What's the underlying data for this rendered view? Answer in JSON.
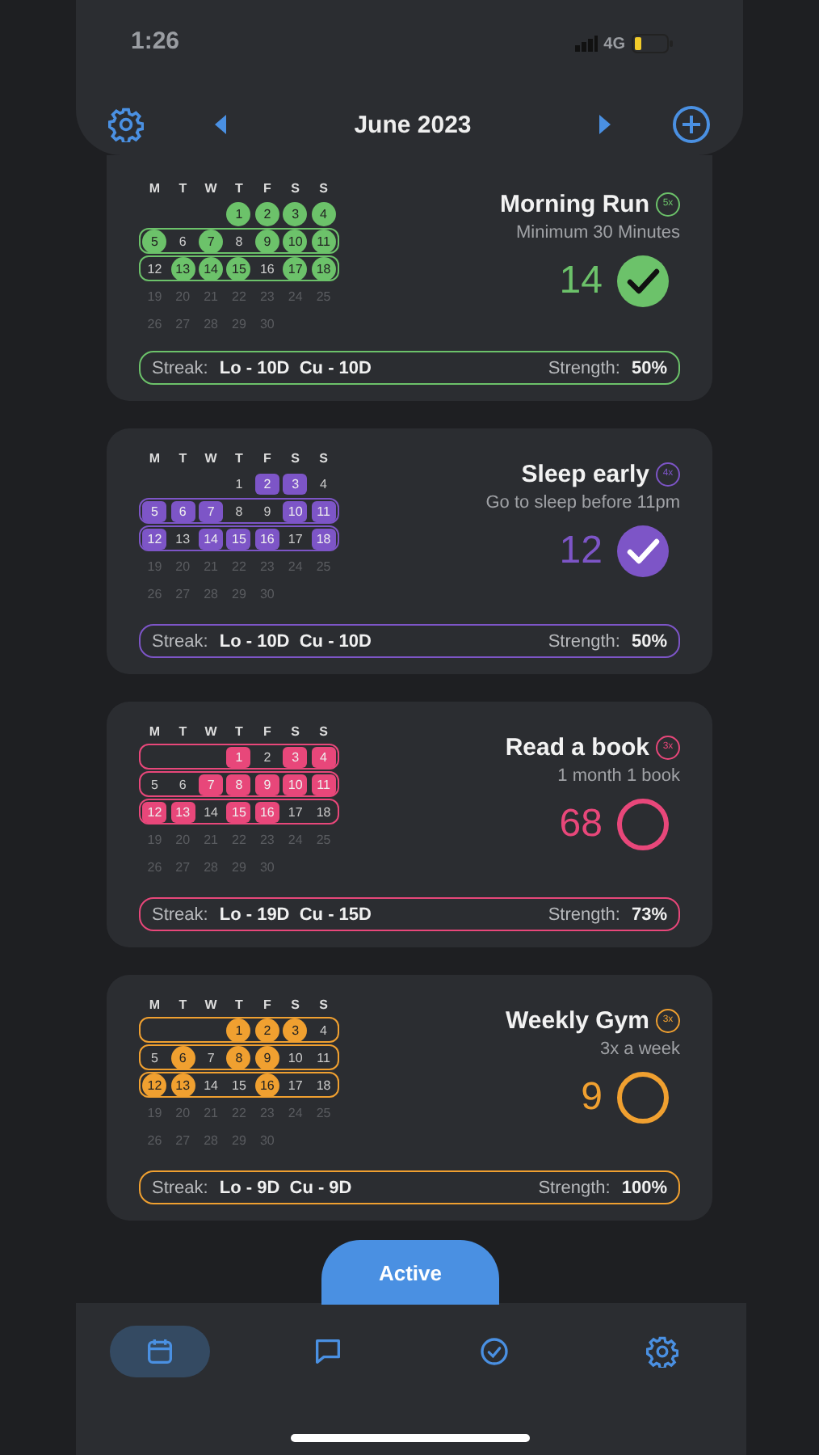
{
  "status_bar": {
    "time": "1:26",
    "network": "4G"
  },
  "header": {
    "month": "June 2023"
  },
  "habits": [
    {
      "name": "Morning Run",
      "kind": "round",
      "badge": "5x",
      "description": "Minimum 30 Minutes",
      "count": "14",
      "done": true,
      "color": "#6cc26a",
      "weekdays": [
        "M",
        "T",
        "W",
        "T",
        "F",
        "S",
        "S"
      ],
      "streak_label": "Streak:",
      "streak_value": "Lo - 10D  Cu - 10D",
      "strength_label": "Strength:",
      "strength_value": "50%",
      "weeks": [
        {
          "outlined": false,
          "starts_midweek": true,
          "days": [
            {
              "label": "1",
              "done": true,
              "future": false
            },
            {
              "label": "2",
              "done": true,
              "future": false
            },
            {
              "label": "3",
              "done": true,
              "future": false
            },
            {
              "label": "4",
              "done": true,
              "future": false
            }
          ]
        },
        {
          "outlined": true,
          "starts_midweek": false,
          "days": [
            {
              "label": "5",
              "done": true,
              "future": false
            },
            {
              "label": "6",
              "done": false,
              "future": false
            },
            {
              "label": "7",
              "done": true,
              "future": false
            },
            {
              "label": "8",
              "done": false,
              "future": false
            },
            {
              "label": "9",
              "done": true,
              "future": false
            },
            {
              "label": "10",
              "done": true,
              "future": false
            },
            {
              "label": "11",
              "done": true,
              "future": false
            }
          ]
        },
        {
          "outlined": true,
          "starts_midweek": false,
          "days": [
            {
              "label": "12",
              "done": false,
              "future": false
            },
            {
              "label": "13",
              "done": true,
              "future": false
            },
            {
              "label": "14",
              "done": true,
              "future": false
            },
            {
              "label": "15",
              "done": true,
              "future": false
            },
            {
              "label": "16",
              "done": false,
              "future": false
            },
            {
              "label": "17",
              "done": true,
              "future": false
            },
            {
              "label": "18",
              "done": true,
              "future": false
            }
          ]
        },
        {
          "outlined": false,
          "starts_midweek": false,
          "days": [
            {
              "label": "19",
              "done": false,
              "future": true
            },
            {
              "label": "20",
              "done": false,
              "future": true
            },
            {
              "label": "21",
              "done": false,
              "future": true
            },
            {
              "label": "22",
              "done": false,
              "future": true
            },
            {
              "label": "23",
              "done": false,
              "future": true
            },
            {
              "label": "24",
              "done": false,
              "future": true
            },
            {
              "label": "25",
              "done": false,
              "future": true
            }
          ]
        },
        {
          "outlined": false,
          "starts_midweek": false,
          "days": [
            {
              "label": "26",
              "done": false,
              "future": true
            },
            {
              "label": "27",
              "done": false,
              "future": true
            },
            {
              "label": "28",
              "done": false,
              "future": true
            },
            {
              "label": "29",
              "done": false,
              "future": true
            },
            {
              "label": "30",
              "done": false,
              "future": true
            }
          ]
        }
      ]
    },
    {
      "name": "Sleep early",
      "kind": "square",
      "badge": "4x",
      "description": "Go to sleep before 11pm",
      "count": "12",
      "done": true,
      "color": "#7d55c7",
      "weekdays": [
        "M",
        "T",
        "W",
        "T",
        "F",
        "S",
        "S"
      ],
      "streak_label": "Streak:",
      "streak_value": "Lo - 10D  Cu - 10D",
      "strength_label": "Strength:",
      "strength_value": "50%",
      "weeks": [
        {
          "outlined": false,
          "starts_midweek": true,
          "days": [
            {
              "label": "1",
              "done": false,
              "future": false
            },
            {
              "label": "2",
              "done": true,
              "future": false
            },
            {
              "label": "3",
              "done": true,
              "future": false
            },
            {
              "label": "4",
              "done": false,
              "future": false
            }
          ]
        },
        {
          "outlined": true,
          "starts_midweek": false,
          "days": [
            {
              "label": "5",
              "done": true,
              "future": false
            },
            {
              "label": "6",
              "done": true,
              "future": false
            },
            {
              "label": "7",
              "done": true,
              "future": false
            },
            {
              "label": "8",
              "done": false,
              "future": false
            },
            {
              "label": "9",
              "done": false,
              "future": false
            },
            {
              "label": "10",
              "done": true,
              "future": false
            },
            {
              "label": "11",
              "done": true,
              "future": false
            }
          ]
        },
        {
          "outlined": true,
          "starts_midweek": false,
          "days": [
            {
              "label": "12",
              "done": true,
              "future": false
            },
            {
              "label": "13",
              "done": false,
              "future": false
            },
            {
              "label": "14",
              "done": true,
              "future": false
            },
            {
              "label": "15",
              "done": true,
              "future": false
            },
            {
              "label": "16",
              "done": true,
              "future": false
            },
            {
              "label": "17",
              "done": false,
              "future": false
            },
            {
              "label": "18",
              "done": true,
              "future": false
            }
          ]
        },
        {
          "outlined": false,
          "starts_midweek": false,
          "days": [
            {
              "label": "19",
              "done": false,
              "future": true
            },
            {
              "label": "20",
              "done": false,
              "future": true
            },
            {
              "label": "21",
              "done": false,
              "future": true
            },
            {
              "label": "22",
              "done": false,
              "future": true
            },
            {
              "label": "23",
              "done": false,
              "future": true
            },
            {
              "label": "24",
              "done": false,
              "future": true
            },
            {
              "label": "25",
              "done": false,
              "future": true
            }
          ]
        },
        {
          "outlined": false,
          "starts_midweek": false,
          "days": [
            {
              "label": "26",
              "done": false,
              "future": true
            },
            {
              "label": "27",
              "done": false,
              "future": true
            },
            {
              "label": "28",
              "done": false,
              "future": true
            },
            {
              "label": "29",
              "done": false,
              "future": true
            },
            {
              "label": "30",
              "done": false,
              "future": true
            }
          ]
        }
      ]
    },
    {
      "name": "Read a book",
      "kind": "square",
      "badge": "3x",
      "description": "1 month 1 book",
      "count": "68",
      "done": false,
      "color": "#e8477a",
      "weekdays": [
        "M",
        "T",
        "W",
        "T",
        "F",
        "S",
        "S"
      ],
      "streak_label": "Streak:",
      "streak_value": "Lo - 19D  Cu - 15D",
      "strength_label": "Strength:",
      "strength_value": "73%",
      "weeks": [
        {
          "outlined": true,
          "starts_midweek": true,
          "days": [
            {
              "label": "1",
              "done": true,
              "future": false
            },
            {
              "label": "2",
              "done": false,
              "future": false
            },
            {
              "label": "3",
              "done": true,
              "future": false
            },
            {
              "label": "4",
              "done": true,
              "future": false
            }
          ]
        },
        {
          "outlined": true,
          "starts_midweek": false,
          "days": [
            {
              "label": "5",
              "done": false,
              "future": false
            },
            {
              "label": "6",
              "done": false,
              "future": false
            },
            {
              "label": "7",
              "done": true,
              "future": false
            },
            {
              "label": "8",
              "done": true,
              "future": false
            },
            {
              "label": "9",
              "done": true,
              "future": false
            },
            {
              "label": "10",
              "done": true,
              "future": false
            },
            {
              "label": "11",
              "done": true,
              "future": false
            }
          ]
        },
        {
          "outlined": true,
          "starts_midweek": false,
          "days": [
            {
              "label": "12",
              "done": true,
              "future": false
            },
            {
              "label": "13",
              "done": true,
              "future": false
            },
            {
              "label": "14",
              "done": false,
              "future": false
            },
            {
              "label": "15",
              "done": true,
              "future": false
            },
            {
              "label": "16",
              "done": true,
              "future": false
            },
            {
              "label": "17",
              "done": false,
              "future": false
            },
            {
              "label": "18",
              "done": false,
              "future": false
            }
          ]
        },
        {
          "outlined": false,
          "starts_midweek": false,
          "days": [
            {
              "label": "19",
              "done": false,
              "future": true
            },
            {
              "label": "20",
              "done": false,
              "future": true
            },
            {
              "label": "21",
              "done": false,
              "future": true
            },
            {
              "label": "22",
              "done": false,
              "future": true
            },
            {
              "label": "23",
              "done": false,
              "future": true
            },
            {
              "label": "24",
              "done": false,
              "future": true
            },
            {
              "label": "25",
              "done": false,
              "future": true
            }
          ]
        },
        {
          "outlined": false,
          "starts_midweek": false,
          "days": [
            {
              "label": "26",
              "done": false,
              "future": true
            },
            {
              "label": "27",
              "done": false,
              "future": true
            },
            {
              "label": "28",
              "done": false,
              "future": true
            },
            {
              "label": "29",
              "done": false,
              "future": true
            },
            {
              "label": "30",
              "done": false,
              "future": true
            }
          ]
        }
      ]
    },
    {
      "name": "Weekly Gym",
      "kind": "round",
      "badge": "3x",
      "description": "3x a week",
      "count": "9",
      "done": false,
      "color": "#f0a030",
      "weekdays": [
        "M",
        "T",
        "W",
        "T",
        "F",
        "S",
        "S"
      ],
      "streak_label": "Streak:",
      "streak_value": "Lo - 9D  Cu - 9D",
      "strength_label": "Strength:",
      "strength_value": "100%",
      "weeks": [
        {
          "outlined": true,
          "starts_midweek": true,
          "days": [
            {
              "label": "1",
              "done": true,
              "future": false
            },
            {
              "label": "2",
              "done": true,
              "future": false
            },
            {
              "label": "3",
              "done": true,
              "future": false
            },
            {
              "label": "4",
              "done": false,
              "future": false
            }
          ]
        },
        {
          "outlined": true,
          "starts_midweek": false,
          "days": [
            {
              "label": "5",
              "done": false,
              "future": false
            },
            {
              "label": "6",
              "done": true,
              "future": false
            },
            {
              "label": "7",
              "done": false,
              "future": false
            },
            {
              "label": "8",
              "done": true,
              "future": false
            },
            {
              "label": "9",
              "done": true,
              "future": false
            },
            {
              "label": "10",
              "done": false,
              "future": false
            },
            {
              "label": "11",
              "done": false,
              "future": false
            }
          ]
        },
        {
          "outlined": true,
          "starts_midweek": false,
          "days": [
            {
              "label": "12",
              "done": true,
              "future": false
            },
            {
              "label": "13",
              "done": true,
              "future": false
            },
            {
              "label": "14",
              "done": false,
              "future": false
            },
            {
              "label": "15",
              "done": false,
              "future": false
            },
            {
              "label": "16",
              "done": true,
              "future": false
            },
            {
              "label": "17",
              "done": false,
              "future": false
            },
            {
              "label": "18",
              "done": false,
              "future": false
            }
          ]
        },
        {
          "outlined": false,
          "starts_midweek": false,
          "days": [
            {
              "label": "19",
              "done": false,
              "future": true
            },
            {
              "label": "20",
              "done": false,
              "future": true
            },
            {
              "label": "21",
              "done": false,
              "future": true
            },
            {
              "label": "22",
              "done": false,
              "future": true
            },
            {
              "label": "23",
              "done": false,
              "future": true
            },
            {
              "label": "24",
              "done": false,
              "future": true
            },
            {
              "label": "25",
              "done": false,
              "future": true
            }
          ]
        },
        {
          "outlined": false,
          "starts_midweek": false,
          "days": [
            {
              "label": "26",
              "done": false,
              "future": true
            },
            {
              "label": "27",
              "done": false,
              "future": true
            },
            {
              "label": "28",
              "done": false,
              "future": true
            },
            {
              "label": "29",
              "done": false,
              "future": true
            },
            {
              "label": "30",
              "done": false,
              "future": true
            }
          ]
        }
      ]
    }
  ],
  "filter_button": {
    "label": "Active"
  },
  "nav": [
    {
      "selected": true
    },
    {
      "selected": false
    },
    {
      "selected": false
    },
    {
      "selected": false
    }
  ]
}
